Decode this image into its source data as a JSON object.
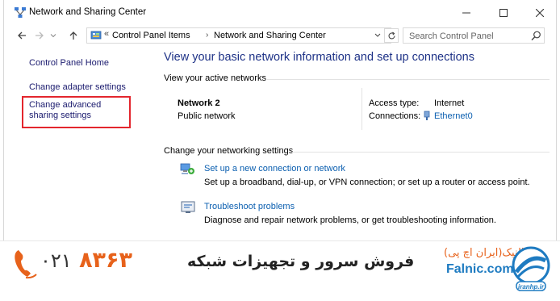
{
  "window": {
    "title": "Network and Sharing Center"
  },
  "address": {
    "crumbs": [
      "Control Panel Items",
      "Network and Sharing Center"
    ],
    "search_placeholder": "Search Control Panel"
  },
  "sidebar": {
    "items": [
      {
        "label": "Control Panel Home"
      },
      {
        "label": "Change adapter settings"
      },
      {
        "label": "Change advanced sharing settings"
      }
    ]
  },
  "main": {
    "title": "View your basic network information and set up connections",
    "active_networks_heading": "View your active networks",
    "network": {
      "name": "Network  2",
      "type": "Public network",
      "access_type_label": "Access type:",
      "access_type_value": "Internet",
      "connections_label": "Connections:",
      "connections_value": "Ethernet0"
    },
    "settings_heading": "Change your networking settings",
    "options": [
      {
        "link": "Set up a new connection or network",
        "description": "Set up a broadband, dial-up, or VPN connection; or set up a router or access point.",
        "icon": "network-setup-icon"
      },
      {
        "link": "Troubleshoot problems",
        "description": "Diagnose and repair network problems, or get troubleshooting information.",
        "icon": "troubleshoot-icon"
      }
    ]
  },
  "banner": {
    "phone_prefix": "۰۲۱",
    "phone_number": "۸۳۶۳",
    "title": "فروش سرور و تجهیزات شبکه",
    "brand_fa": "فالنیک(ایران اچ پی)",
    "brand_en": "Falnic.com",
    "accent_color": "#e7621b",
    "brand_color": "#1e7bc1"
  }
}
